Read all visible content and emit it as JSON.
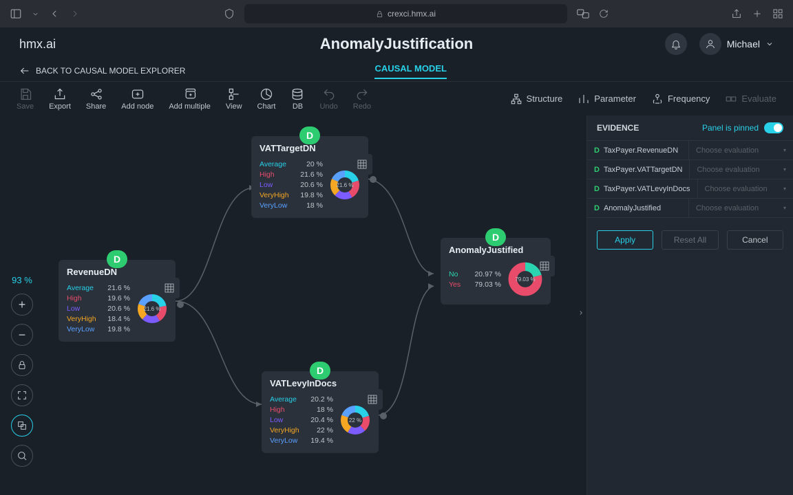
{
  "browser": {
    "url": "crexci.hmx.ai"
  },
  "brand": "hmx.ai",
  "page_title": "AnomalyJustification",
  "user": {
    "name": "Michael"
  },
  "back": "BACK TO CAUSAL MODEL EXPLORER",
  "active_tab": "CAUSAL MODEL",
  "toolbar": {
    "save": "Save",
    "export": "Export",
    "share": "Share",
    "add_node": "Add node",
    "add_multiple": "Add multiple",
    "view": "View",
    "chart": "Chart",
    "db": "DB",
    "undo": "Undo",
    "redo": "Redo",
    "structure": "Structure",
    "parameter": "Parameter",
    "frequency": "Frequency",
    "evaluate": "Evaluate"
  },
  "zoom": {
    "pct": "93 %"
  },
  "evidence": {
    "title": "EVIDENCE",
    "pin_label": "Panel is pinned",
    "placeholder": "Choose evaluation",
    "rows": [
      {
        "d": "D",
        "name": "TaxPayer.RevenueDN"
      },
      {
        "d": "D",
        "name": "TaxPayer.VATTargetDN"
      },
      {
        "d": "D",
        "name": "TaxPayer.VATLevyInDocs"
      },
      {
        "d": "D",
        "name": "AnomalyJustified"
      }
    ],
    "apply": "Apply",
    "reset": "Reset All",
    "cancel": "Cancel"
  },
  "nodes": {
    "revenue": {
      "title": "RevenueDN",
      "badge": "D",
      "center": "21.6 %",
      "stats": [
        {
          "lbl": "Average",
          "val": "21.6 %",
          "cls": "c-avg"
        },
        {
          "lbl": "High",
          "val": "19.6 %",
          "cls": "c-high"
        },
        {
          "lbl": "Low",
          "val": "20.6 %",
          "cls": "c-low"
        },
        {
          "lbl": "VeryHigh",
          "val": "18.4 %",
          "cls": "c-vhigh"
        },
        {
          "lbl": "VeryLow",
          "val": "19.8 %",
          "cls": "c-vlow"
        }
      ]
    },
    "vattarget": {
      "title": "VATTargetDN",
      "badge": "D",
      "center": "21.6 %",
      "stats": [
        {
          "lbl": "Average",
          "val": "20 %",
          "cls": "c-avg"
        },
        {
          "lbl": "High",
          "val": "21.6 %",
          "cls": "c-high"
        },
        {
          "lbl": "Low",
          "val": "20.6 %",
          "cls": "c-low"
        },
        {
          "lbl": "VeryHigh",
          "val": "19.8 %",
          "cls": "c-vhigh"
        },
        {
          "lbl": "VeryLow",
          "val": "18 %",
          "cls": "c-vlow"
        }
      ]
    },
    "vatlevy": {
      "title": "VATLevyInDocs",
      "badge": "D",
      "center": "22 %",
      "stats": [
        {
          "lbl": "Average",
          "val": "20.2 %",
          "cls": "c-avg"
        },
        {
          "lbl": "High",
          "val": "18 %",
          "cls": "c-high"
        },
        {
          "lbl": "Low",
          "val": "20.4 %",
          "cls": "c-low"
        },
        {
          "lbl": "VeryHigh",
          "val": "22 %",
          "cls": "c-vhigh"
        },
        {
          "lbl": "VeryLow",
          "val": "19.4 %",
          "cls": "c-vlow"
        }
      ]
    },
    "anomaly": {
      "title": "AnomalyJustified",
      "badge": "D",
      "center": "79.03 %",
      "stats": [
        {
          "lbl": "No",
          "val": "20.97 %",
          "cls": "c-no"
        },
        {
          "lbl": "Yes",
          "val": "79.03 %",
          "cls": "c-yes"
        }
      ]
    }
  },
  "chart_data": [
    {
      "type": "pie",
      "title": "RevenueDN",
      "series": [
        {
          "name": "Average",
          "value": 21.6
        },
        {
          "name": "High",
          "value": 19.6
        },
        {
          "name": "Low",
          "value": 20.6
        },
        {
          "name": "VeryHigh",
          "value": 18.4
        },
        {
          "name": "VeryLow",
          "value": 19.8
        }
      ]
    },
    {
      "type": "pie",
      "title": "VATTargetDN",
      "series": [
        {
          "name": "Average",
          "value": 20
        },
        {
          "name": "High",
          "value": 21.6
        },
        {
          "name": "Low",
          "value": 20.6
        },
        {
          "name": "VeryHigh",
          "value": 19.8
        },
        {
          "name": "VeryLow",
          "value": 18
        }
      ]
    },
    {
      "type": "pie",
      "title": "VATLevyInDocs",
      "series": [
        {
          "name": "Average",
          "value": 20.2
        },
        {
          "name": "High",
          "value": 18
        },
        {
          "name": "Low",
          "value": 20.4
        },
        {
          "name": "VeryHigh",
          "value": 22
        },
        {
          "name": "VeryLow",
          "value": 19.4
        }
      ]
    },
    {
      "type": "pie",
      "title": "AnomalyJustified",
      "series": [
        {
          "name": "No",
          "value": 20.97
        },
        {
          "name": "Yes",
          "value": 79.03
        }
      ]
    }
  ]
}
